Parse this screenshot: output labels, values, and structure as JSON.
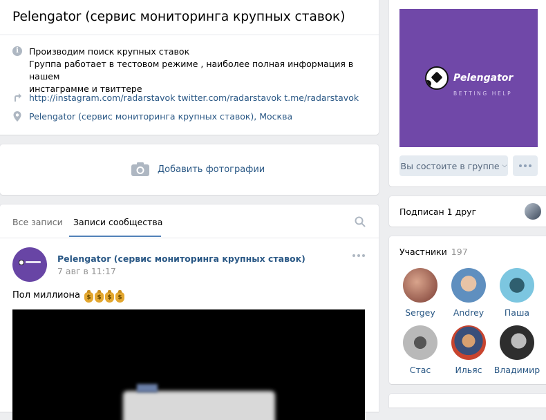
{
  "group": {
    "title": "Pelengator (сервис мониторинга крупных ставок)",
    "description_line1": "Производим поиск крупных ставок",
    "description_line2": "Группа работает в тестовом режиме , наиболее полная информация в нашем",
    "description_line3": "инстаграмме и твиттере",
    "links": "http://instagram.com/radarstavok twitter.com/radarstavok t.me/radarstavok",
    "address": "Pelengator (сервис мониторинга крупных ставок), Москва"
  },
  "photos": {
    "add_label": "Добавить фотографии"
  },
  "wall": {
    "tabs": [
      "Все записи",
      "Записи сообщества"
    ],
    "active_tab": "Записи сообщества",
    "post": {
      "author": "Pelengator (сервис мониторинга крупных ставок)",
      "date": "7 авг в 11:17",
      "text": "Пол миллиона",
      "emoji": [
        "money-bag",
        "money-bag",
        "money-bag",
        "money-bag"
      ]
    }
  },
  "sidebar": {
    "cover": {
      "logo_name": "Pelengator",
      "logo_sub": "BETTING HELP",
      "bg_color": "#7048a8"
    },
    "member_button": "Вы состоите в группе",
    "friend_text": "Подписан 1 друг",
    "members": {
      "title": "Участники",
      "count": "197",
      "people": [
        {
          "name": "Sergey",
          "color": "#a0625a"
        },
        {
          "name": "Andrey",
          "color": "#6f9ac4"
        },
        {
          "name": "Паша",
          "color": "#5aa6c7"
        },
        {
          "name": "Стас",
          "color": "#8c8c8c"
        },
        {
          "name": "Ильяс",
          "color": "#b04a3a"
        },
        {
          "name": "Владимир",
          "color": "#4a4a4a"
        }
      ]
    }
  }
}
